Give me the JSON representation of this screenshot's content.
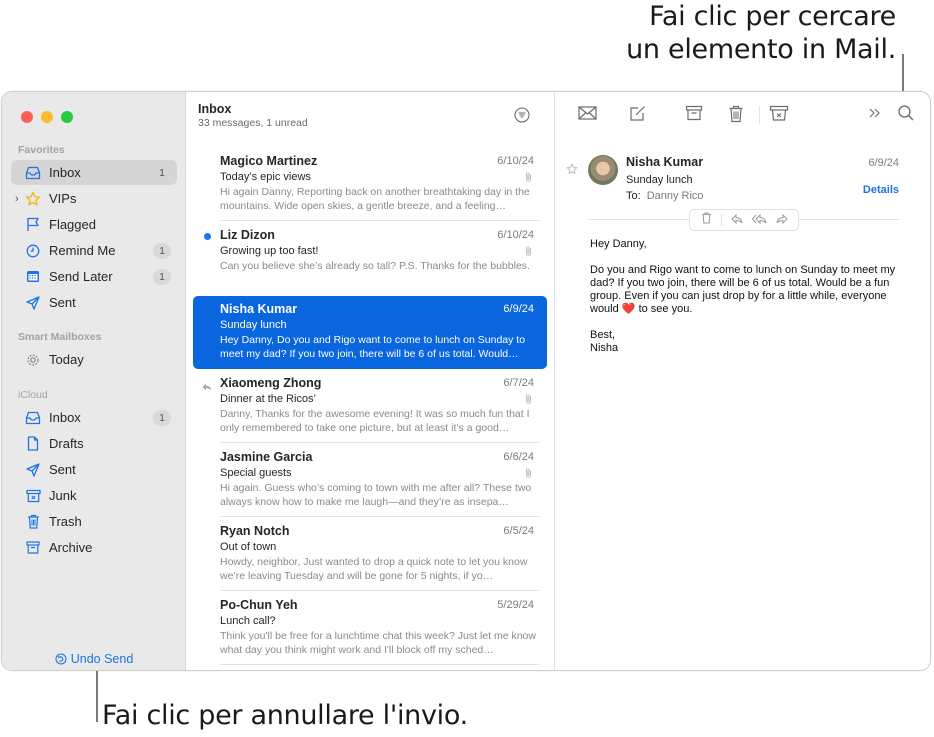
{
  "callouts": {
    "search_line1": "Fai clic per cercare",
    "search_line2": "un elemento in Mail.",
    "undo": "Fai clic per annullare l'invio."
  },
  "window": {
    "traffic_lights": {
      "close": "#fe5f57",
      "minimize": "#febc2e",
      "zoom": "#28c840"
    }
  },
  "sidebar": {
    "sections": [
      {
        "label": "Favorites",
        "items": [
          {
            "label": "Inbox",
            "icon": "inbox-icon",
            "badge": "1",
            "selected": true
          },
          {
            "label": "VIPs",
            "icon": "star-icon",
            "badge": "",
            "disclosure": "›"
          },
          {
            "label": "Flagged",
            "icon": "flag-icon",
            "badge": ""
          },
          {
            "label": "Remind Me",
            "icon": "clock-icon",
            "badge": "1"
          },
          {
            "label": "Send Later",
            "icon": "calendar-icon",
            "badge": "1"
          },
          {
            "label": "Sent",
            "icon": "paper-plane-icon",
            "badge": ""
          }
        ]
      },
      {
        "label": "Smart Mailboxes",
        "items": [
          {
            "label": "Today",
            "icon": "gear-icon",
            "badge": ""
          }
        ]
      },
      {
        "label": "iCloud",
        "items": [
          {
            "label": "Inbox",
            "icon": "inbox-icon",
            "badge": "1"
          },
          {
            "label": "Drafts",
            "icon": "document-icon",
            "badge": ""
          },
          {
            "label": "Sent",
            "icon": "paper-plane-icon",
            "badge": ""
          },
          {
            "label": "Junk",
            "icon": "junk-icon",
            "badge": ""
          },
          {
            "label": "Trash",
            "icon": "trash-icon",
            "badge": ""
          },
          {
            "label": "Archive",
            "icon": "archive-icon",
            "badge": ""
          }
        ]
      }
    ],
    "undo_send": "Undo Send"
  },
  "message_list": {
    "title": "Inbox",
    "subtitle": "33 messages, 1 unread",
    "messages": [
      {
        "sender": "Magico Martinez",
        "date": "6/10/24",
        "subject": "Today’s epic views",
        "preview": "Hi again Danny, Reporting back on another breathtaking day in the mountains. Wide open skies, a gentle breeze, and a feeling…",
        "attachment": true,
        "unread": false,
        "replied": false,
        "selected": false
      },
      {
        "sender": "Liz Dizon",
        "date": "6/10/24",
        "subject": "Growing up too fast!",
        "preview": "Can you believe she’s already so tall? P.S. Thanks for the bubbles.",
        "attachment": true,
        "unread": true,
        "replied": false,
        "selected": false
      },
      {
        "sender": "Nisha Kumar",
        "date": "6/9/24",
        "subject": "Sunday lunch",
        "preview": "Hey Danny, Do you and Rigo want to come to lunch on Sunday to meet my dad? If you two join, there will be 6 of us total. Would…",
        "attachment": false,
        "unread": false,
        "replied": false,
        "selected": true
      },
      {
        "sender": "Xiaomeng Zhong",
        "date": "6/7/24",
        "subject": "Dinner at the Ricos’",
        "preview": "Danny, Thanks for the awesome evening! It was so much fun that I only remembered to take one picture, but at least it’s a good…",
        "attachment": true,
        "unread": false,
        "replied": true,
        "selected": false
      },
      {
        "sender": "Jasmine Garcia",
        "date": "6/6/24",
        "subject": "Special guests",
        "preview": "Hi again. Guess who’s coming to town with me after all? These two always know how to make me laugh—and they’re as insepa…",
        "attachment": true,
        "unread": false,
        "replied": false,
        "selected": false
      },
      {
        "sender": "Ryan Notch",
        "date": "6/5/24",
        "subject": "Out of town",
        "preview": "Howdy, neighbor, Just wanted to drop a quick note to let you know we’re leaving Tuesday and will be gone for 5 nights, if yo…",
        "attachment": false,
        "unread": false,
        "replied": false,
        "selected": false
      },
      {
        "sender": "Po-Chun Yeh",
        "date": "5/29/24",
        "subject": "Lunch call?",
        "preview": "Think you'll be free for a lunchtime chat this week? Just let me know what day you think might work and I'll block off my sched…",
        "attachment": false,
        "unread": false,
        "replied": false,
        "selected": false
      }
    ]
  },
  "reader": {
    "toolbar": [
      "envelope-icon",
      "compose-icon",
      "archive-icon",
      "trash-icon",
      "junk-icon",
      "more-chevrons-icon",
      "search-icon"
    ],
    "sender": "Nisha Kumar",
    "date": "6/9/24",
    "subject": "Sunday lunch",
    "to_label": "To:",
    "to_name": "Danny Rico",
    "details_link": "Details",
    "body": {
      "greeting": "Hey Danny,",
      "paragraph_before_heart": "Do you and Rigo want to come to lunch on Sunday to meet my dad? If you two join, there will be 6 of us total. Would be a fun group. Even if you can just drop by for a little while, everyone would",
      "heart": "❤️",
      "paragraph_after_heart": "to see you.",
      "signoff": "Best,",
      "signature": "Nisha"
    }
  }
}
